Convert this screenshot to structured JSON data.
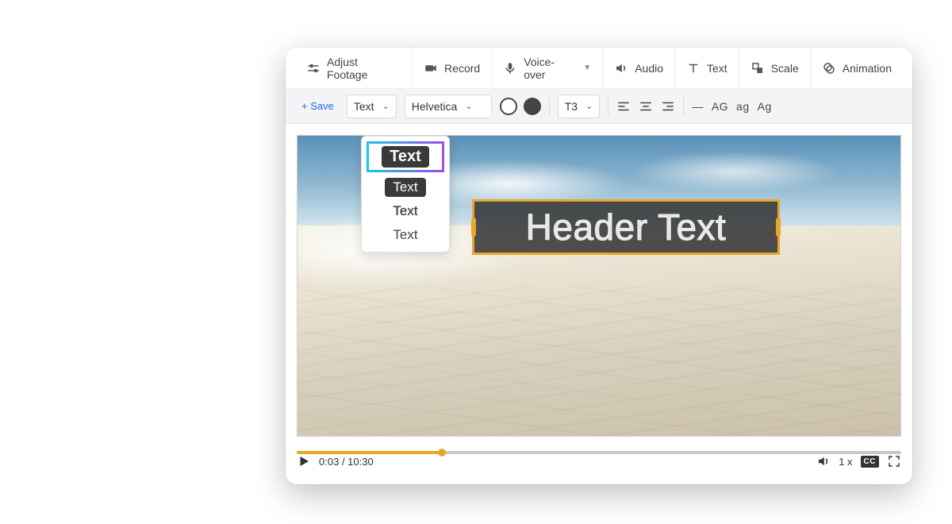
{
  "toolbar": {
    "adjust_footage": "Adjust Footage",
    "record": "Record",
    "voice_over": "Voice-over",
    "audio": "Audio",
    "text": "Text",
    "scale": "Scale",
    "animation": "Animation"
  },
  "subtoolbar": {
    "save_label": "+ Save",
    "text_dd": "Text",
    "font_dd": "Helvetica",
    "textsize_dd": "T3",
    "case_upper": "AG",
    "case_lower": "ag",
    "case_title": "Ag",
    "minus": "—"
  },
  "text_styles": [
    "Text",
    "Text",
    "Text",
    "Text"
  ],
  "canvas": {
    "header_text": "Header Text"
  },
  "player": {
    "current_time": "0:03",
    "duration": "10:30",
    "speed": "1 x",
    "cc": "CC"
  }
}
